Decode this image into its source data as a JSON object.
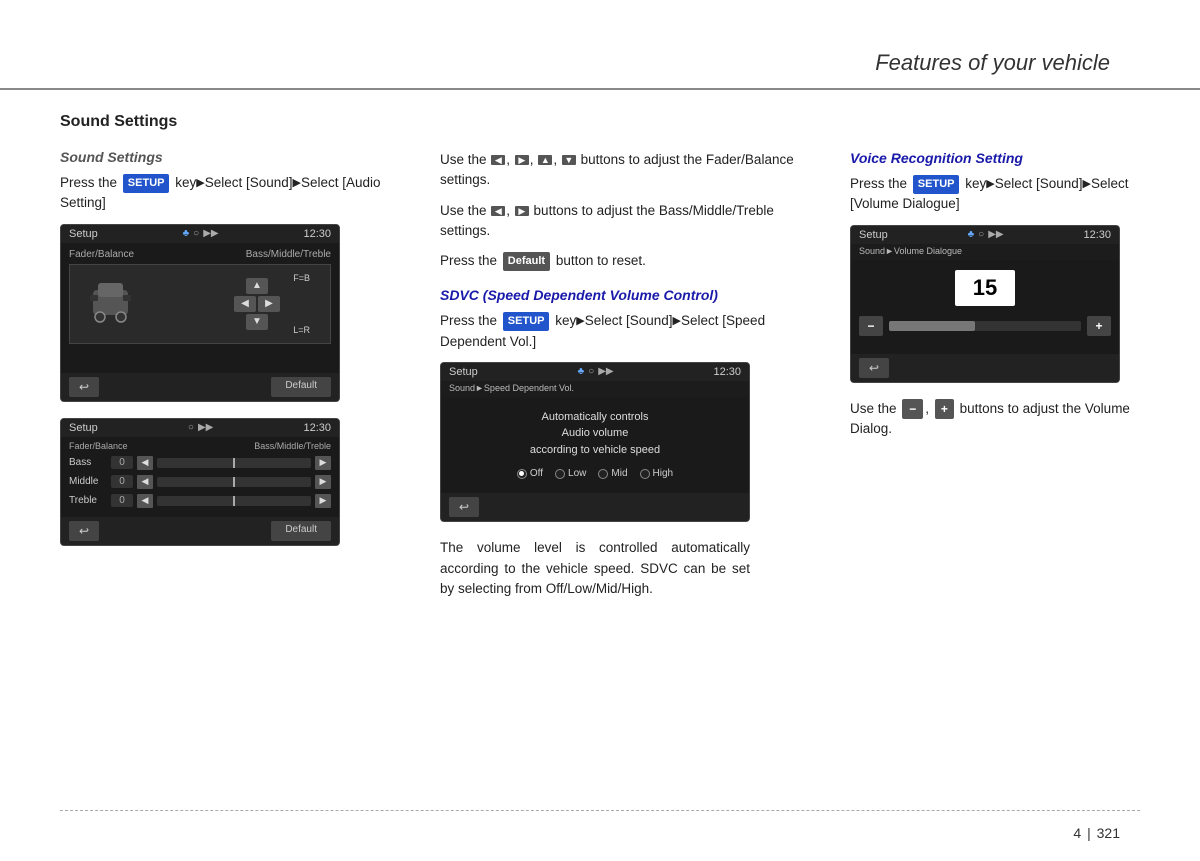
{
  "header": {
    "title": "Features of your vehicle"
  },
  "footer": {
    "page": "4",
    "section": "321"
  },
  "left_column": {
    "main_title": "Sound Settings",
    "subtitle": "Sound Settings",
    "para1_pre": "Press the",
    "para1_badge": "SETUP",
    "para1_post": "key▶Select [Sound]▶Select [Audio Setting]",
    "screen1": {
      "header_title": "Setup",
      "header_icons": "bluetooth wifi audio",
      "header_time": "12:30",
      "labels": [
        "Fader/Balance",
        "Bass/Middle/Treble"
      ],
      "fb": "F=B",
      "lr": "L=R",
      "footer_back": "↩",
      "footer_default": "Default"
    },
    "screen2": {
      "header_title": "Setup",
      "header_time": "12:30",
      "labels": [
        "Fader/Balance",
        "Bass/Middle/Treble"
      ],
      "rows": [
        {
          "label": "Bass",
          "value": "0"
        },
        {
          "label": "Middle",
          "value": "0"
        },
        {
          "label": "Treble",
          "value": "0"
        }
      ],
      "footer_back": "↩",
      "footer_default": "Default"
    }
  },
  "mid_column": {
    "para_buttons": "Use the  ◀ ,  ▶ ,  ▲ ,  ▼  buttons to adjust the Fader/Balance settings.",
    "para_bass": "Use the  ◀ ,  ▶  buttons to adjust the Bass/Middle/Treble settings.",
    "para_default": "Press the  Default  button to reset.",
    "sdvc_title": "SDVC (Speed Dependent Volume Control)",
    "sdvc_para1_pre": "Press the",
    "sdvc_para1_badge": "SETUP",
    "sdvc_para1_post": "key▶Select [Sound]▶Select [Speed Dependent Vol.]",
    "screen3": {
      "header_title": "Setup",
      "header_time": "12:30",
      "breadcrumb": "Sound▶Speed Dependent Vol.",
      "body_text": "Automatically controls\nAudio volume\naccording to vehicle speed",
      "options": [
        "Off",
        "Low",
        "Mid",
        "High"
      ],
      "active_option": "Off",
      "footer_back": "↩"
    },
    "sdvc_desc": "The volume level is controlled automatically according to the vehicle speed. SDVC can be set by selecting from Off/Low/Mid/High."
  },
  "right_column": {
    "title": "Voice Recognition Setting",
    "para1_pre": "Press the",
    "para1_badge": "SETUP",
    "para1_key": "key▶Select [Sound]▶Select [Volume Dialogue]",
    "screen4": {
      "header_title": "Setup",
      "header_time": "12:30",
      "breadcrumb": "Sound▶Volume Dialogue",
      "volume_value": "15",
      "footer_back": "↩"
    },
    "para2_pre": "Use the",
    "para2_minus": "−",
    "para2_comma": ",",
    "para2_plus": "+",
    "para2_post": "buttons to adjust the Volume Dialog."
  }
}
